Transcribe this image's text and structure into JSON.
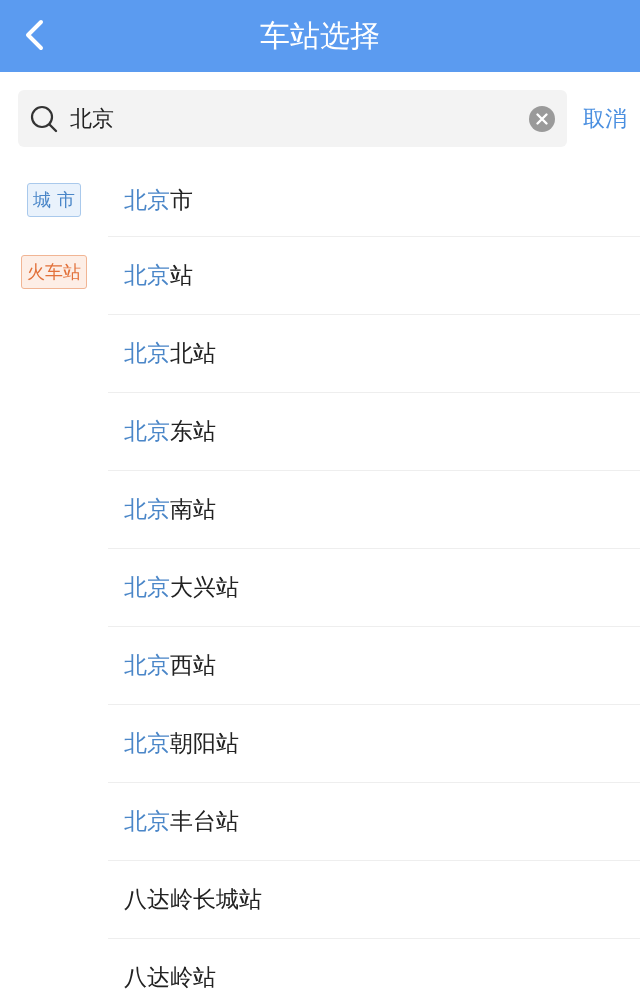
{
  "header": {
    "title": "车站选择"
  },
  "search": {
    "value": "北京",
    "cancel": "取消"
  },
  "groups": [
    {
      "tag": "城 市",
      "kind": "city",
      "items": [
        {
          "highlight": "北京",
          "rest": "市"
        }
      ]
    },
    {
      "tag": "火车站",
      "kind": "station",
      "items": [
        {
          "highlight": "北京",
          "rest": "站"
        },
        {
          "highlight": "北京",
          "rest": "北站"
        },
        {
          "highlight": "北京",
          "rest": "东站"
        },
        {
          "highlight": "北京",
          "rest": "南站"
        },
        {
          "highlight": "北京",
          "rest": "大兴站"
        },
        {
          "highlight": "北京",
          "rest": "西站"
        },
        {
          "highlight": "北京",
          "rest": "朝阳站"
        },
        {
          "highlight": "北京",
          "rest": "丰台站"
        },
        {
          "rest": "八达岭长城站"
        },
        {
          "rest": "八达岭站"
        }
      ]
    }
  ]
}
